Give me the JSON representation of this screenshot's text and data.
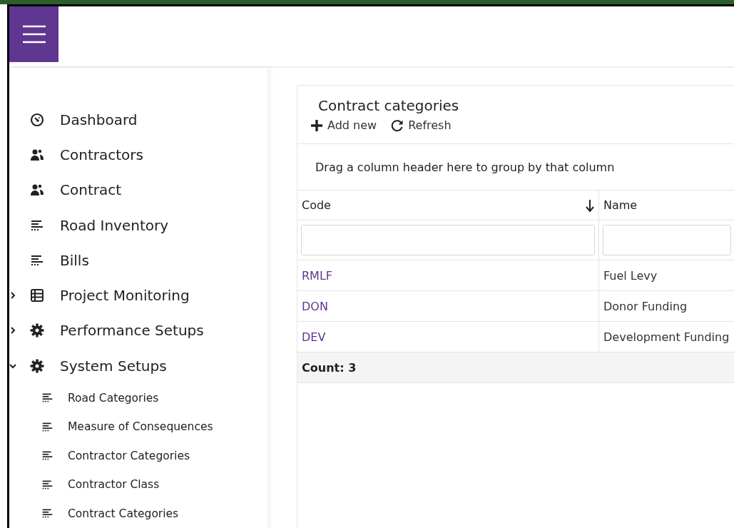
{
  "sidebar": {
    "items": [
      {
        "label": "Dashboard",
        "kind": "dashboard"
      },
      {
        "label": "Contractors",
        "kind": "people"
      },
      {
        "label": "Contract",
        "kind": "people"
      },
      {
        "label": "Road Inventory",
        "kind": "list"
      },
      {
        "label": "Bills",
        "kind": "list"
      },
      {
        "label": "Project Monitoring",
        "kind": "table",
        "expanded": false
      },
      {
        "label": "Performance Setups",
        "kind": "gear",
        "expanded": false
      },
      {
        "label": "System Setups",
        "kind": "gear",
        "expanded": true,
        "children": [
          {
            "label": "Road Categories",
            "kind": "list"
          },
          {
            "label": "Measure of Consequences",
            "kind": "list"
          },
          {
            "label": "Contractor Categories",
            "kind": "list"
          },
          {
            "label": "Contractor Class",
            "kind": "list"
          },
          {
            "label": "Contract Categories",
            "kind": "list"
          }
        ]
      }
    ]
  },
  "panel": {
    "title": "Contract categories",
    "toolbar": [
      {
        "label": "Add new",
        "kind": "plus"
      },
      {
        "label": "Refresh",
        "kind": "refresh"
      }
    ],
    "group_panel": "Drag a column header here to group by that column",
    "table": {
      "columns": [
        {
          "label": "Code",
          "sorted": true
        },
        {
          "label": "Name",
          "sorted": false
        }
      ],
      "rows": [
        [
          "RMLF",
          "Fuel Levy"
        ],
        [
          "DON",
          "Donor Funding"
        ],
        [
          "DEV",
          "Development Funding"
        ]
      ],
      "footer": "Count: 3"
    }
  }
}
